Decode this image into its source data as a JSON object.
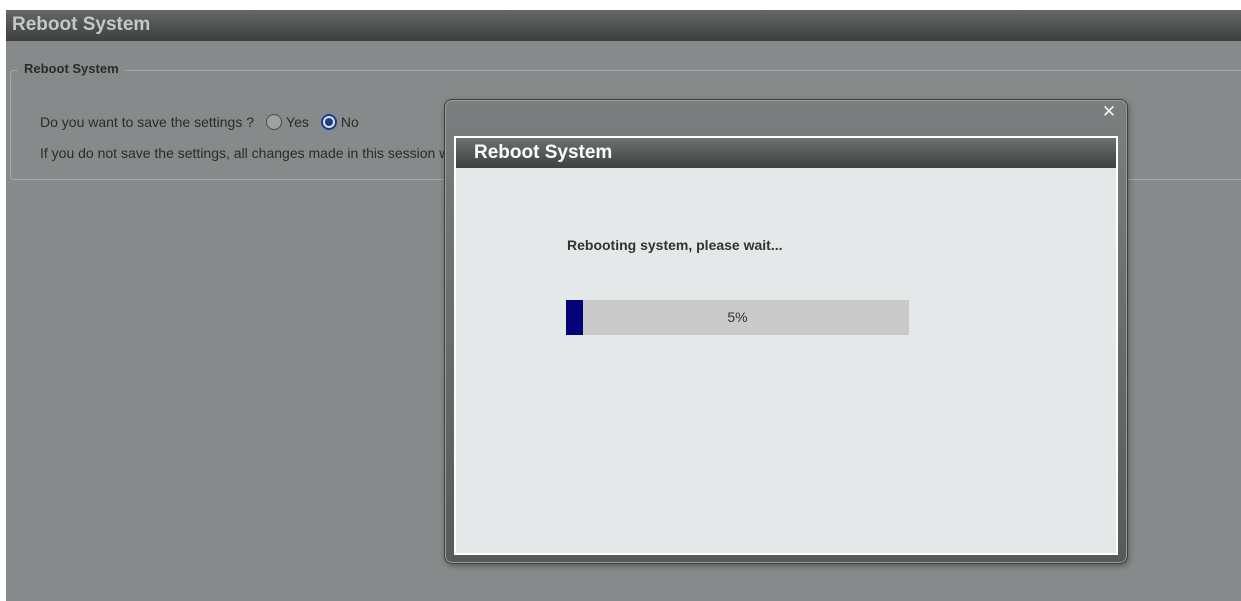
{
  "page": {
    "title": "Reboot System",
    "section_legend": "Reboot System",
    "question": "Do you want to save the settings ?",
    "options": [
      {
        "label": "Yes",
        "checked": false
      },
      {
        "label": "No",
        "checked": true
      }
    ],
    "note": "If you do not save the settings, all changes made in this session will be lost."
  },
  "modal": {
    "close_icon": "close-icon",
    "title": "Reboot System",
    "status": "Rebooting system, please wait...",
    "progress": {
      "percent": 5,
      "label": "5%"
    }
  },
  "colors": {
    "progress_fill": "#040478",
    "progress_track": "#cacaca",
    "radio_selected": "#1c3d8a"
  }
}
